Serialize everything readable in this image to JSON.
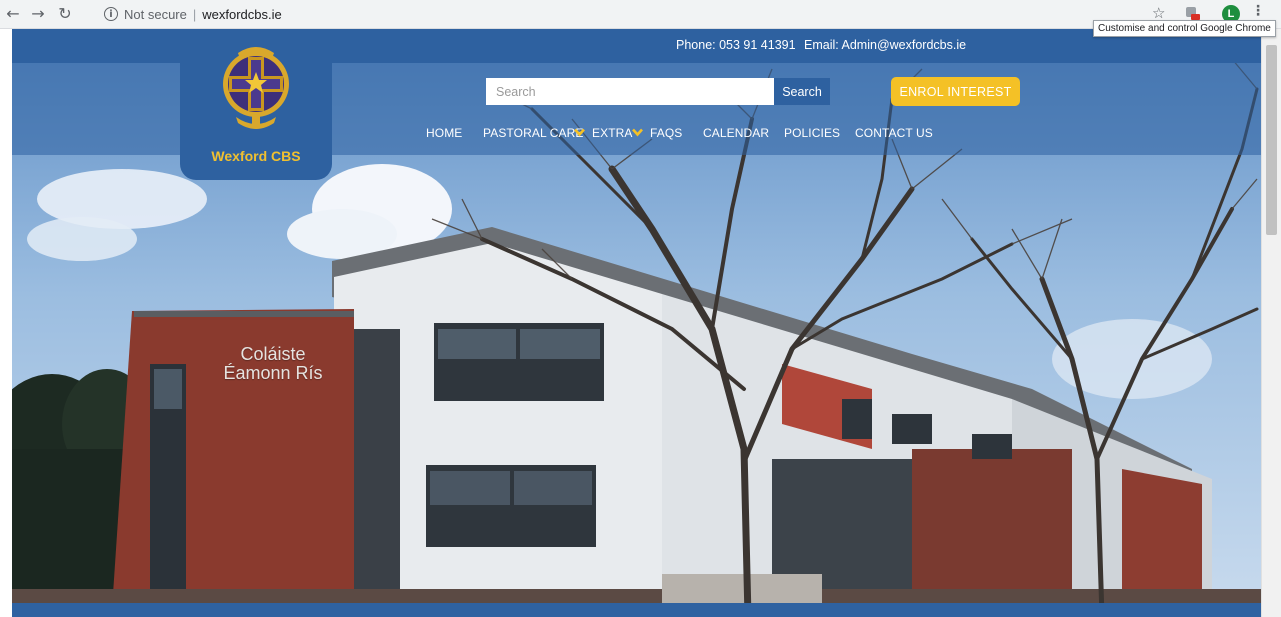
{
  "browser": {
    "back_icon": "arrow-left-icon",
    "forward_icon": "arrow-right-icon",
    "reload_icon": "reload-icon",
    "security_label": "Not secure",
    "separator": "|",
    "url": "wexfordcbs.ie",
    "avatar_initial": "L",
    "tooltip": "Customise and control Google Chrome"
  },
  "header": {
    "phone": "Phone: 053 91 41391",
    "email": "Email: Admin@wexfordcbs.ie",
    "logo_text": "Wexford CBS",
    "search_placeholder": "Search",
    "search_button": "Search",
    "enrol_button": "ENROL INTEREST"
  },
  "nav": {
    "items": [
      "HOME",
      "PASTORAL CARE",
      "EXTRA",
      "FAQS",
      "CALENDAR",
      "POLICIES",
      "CONTACT US"
    ],
    "dropdown_icon_color": "#f4c126"
  },
  "hero": {
    "building_sign_line1": "Coláiste",
    "building_sign_line2": "Éamonn Rís"
  },
  "colors": {
    "brand_blue": "#2e61a0",
    "accent_yellow": "#f4c126",
    "logo_text": "#f0c030"
  }
}
